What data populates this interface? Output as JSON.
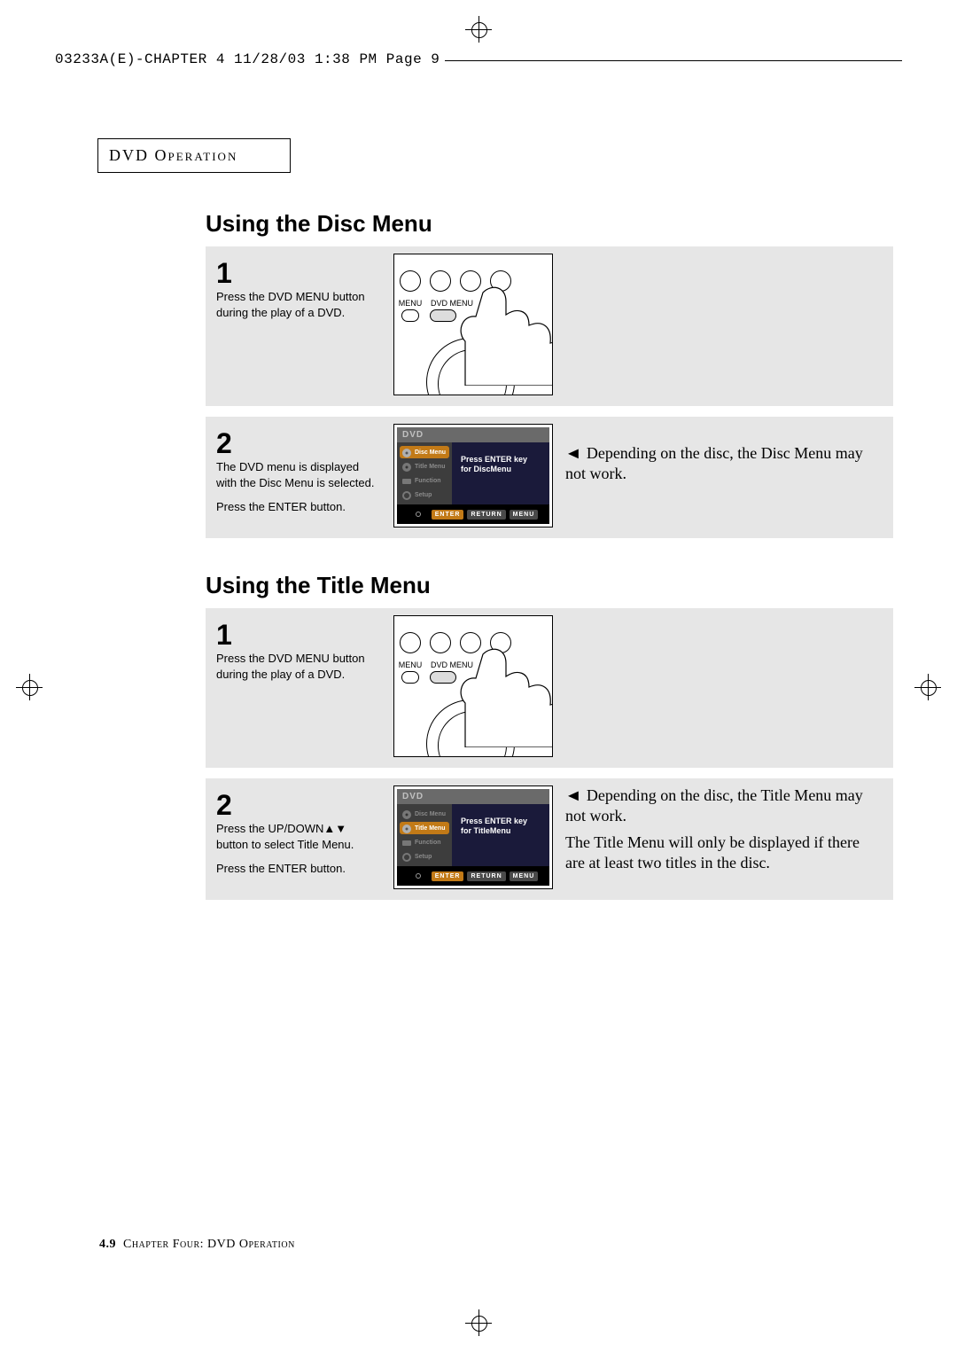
{
  "print_header": "03233A(E)-CHAPTER 4  11/28/03  1:38 PM  Page 9",
  "chapter_tab": "DVD Operation",
  "remote_labels": {
    "menu": "MENU",
    "dvd_menu": "DVD MENU"
  },
  "section_disc": {
    "heading": "Using the Disc Menu",
    "step1_num": "1",
    "step1_text": "Press the DVD MENU button during the play of a DVD.",
    "step2_num": "2",
    "step2_text1": "The DVD menu is displayed with the Disc Menu is selected.",
    "step2_text2": "Press the ENTER button.",
    "step2_note": "Depending on the disc, the Disc Menu may not work.",
    "osd": {
      "top": "DVD",
      "rows": [
        {
          "label": "Disc Menu",
          "selected": true
        },
        {
          "label": "Title Menu",
          "selected": false
        },
        {
          "label": "Function",
          "selected": false
        },
        {
          "label": "Setup",
          "selected": false
        }
      ],
      "right_l1": "Press ENTER key",
      "right_l2": "for DiscMenu",
      "btns": {
        "enter": "ENTER",
        "return": "RETURN",
        "menu": "MENU"
      }
    }
  },
  "section_title": {
    "heading": "Using the Title Menu",
    "step1_num": "1",
    "step1_text": "Press the DVD MENU button during the play of a DVD.",
    "step2_num": "2",
    "step2_text1": "Press the UP/DOWN▲▼ button to select Title Menu.",
    "step2_text2": "Press the ENTER button.",
    "step2_note1": "Depending on the disc, the Title Menu may not work.",
    "step2_note2": "The Title Menu will only be displayed if there are at least two titles in the disc.",
    "osd": {
      "top": "DVD",
      "rows": [
        {
          "label": "Disc Menu",
          "selected": false
        },
        {
          "label": "Title Menu",
          "selected": true
        },
        {
          "label": "Function",
          "selected": false
        },
        {
          "label": "Setup",
          "selected": false
        }
      ],
      "right_l1": "Press ENTER key",
      "right_l2": "for TitleMenu",
      "btns": {
        "enter": "ENTER",
        "return": "RETURN",
        "menu": "MENU"
      }
    }
  },
  "footer": {
    "pg": "4.9",
    "txt": "Chapter Four: DVD Operation"
  }
}
